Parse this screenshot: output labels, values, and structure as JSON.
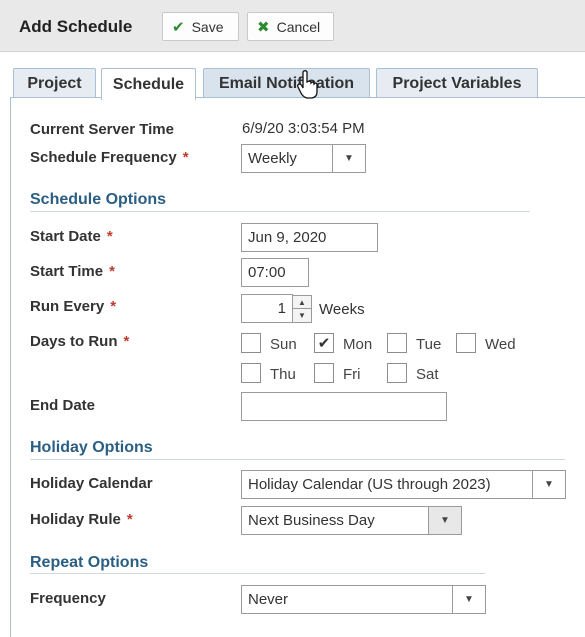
{
  "toolbar": {
    "title": "Add Schedule",
    "save_label": "Save",
    "cancel_label": "Cancel",
    "save_icon": "check-icon",
    "cancel_icon": "x-icon"
  },
  "tabs": [
    {
      "label": "Project"
    },
    {
      "label": "Schedule"
    },
    {
      "label": "Email Notification"
    },
    {
      "label": "Project Variables"
    }
  ],
  "active_tab": "Schedule",
  "general": {
    "server_time_label": "Current Server Time",
    "server_time_value": "6/9/20 3:03:54 PM",
    "frequency_label": "Schedule Frequency",
    "frequency_value": "Weekly"
  },
  "schedule_options": {
    "heading": "Schedule Options",
    "start_date_label": "Start Date",
    "start_date_value": "Jun 9, 2020",
    "start_time_label": "Start Time",
    "start_time_value": "07:00",
    "run_every_label": "Run Every",
    "run_every_value": "1",
    "run_every_unit": "Weeks",
    "days_label": "Days to Run",
    "days": [
      {
        "label": "Sun",
        "checked": false
      },
      {
        "label": "Mon",
        "checked": true
      },
      {
        "label": "Tue",
        "checked": false
      },
      {
        "label": "Wed",
        "checked": false
      },
      {
        "label": "Thu",
        "checked": false
      },
      {
        "label": "Fri",
        "checked": false
      },
      {
        "label": "Sat",
        "checked": false
      }
    ],
    "end_date_label": "End Date",
    "end_date_value": ""
  },
  "holiday_options": {
    "heading": "Holiday Options",
    "calendar_label": "Holiday Calendar",
    "calendar_value": "Holiday Calendar (US through 2023)",
    "rule_label": "Holiday Rule",
    "rule_value": "Next Business Day"
  },
  "repeat_options": {
    "heading": "Repeat Options",
    "frequency_label": "Frequency",
    "frequency_value": "Never"
  },
  "required_marker": "*",
  "colors": {
    "section_heading": "#2a5f83",
    "required": "#c0392b",
    "check": "#2e8b2e",
    "tab_border": "#a9bfd2"
  }
}
